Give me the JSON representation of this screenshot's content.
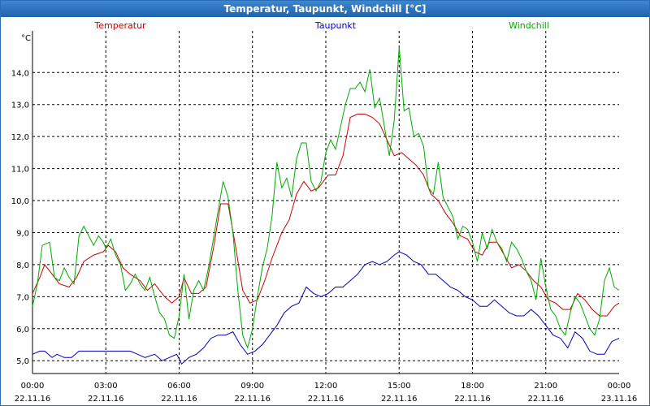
{
  "window": {
    "title": "Temperatur, Taupunkt, Windchill [°C]"
  },
  "chart_data": {
    "type": "line",
    "title": "Temperatur, Taupunkt, Windchill [°C]",
    "ylabel": "°C",
    "ylim": [
      4.6,
      15.3
    ],
    "xlim": [
      0,
      24
    ],
    "grid": true,
    "legend": "top",
    "y_ticks": [
      "5,0",
      "6,0",
      "7,0",
      "8,0",
      "9,0",
      "10,0",
      "11,0",
      "12,0",
      "13,0",
      "14,0"
    ],
    "y_tick_values": [
      5,
      6,
      7,
      8,
      9,
      10,
      11,
      12,
      13,
      14
    ],
    "x_ticks": [
      {
        "hour": 0,
        "time": "00:00",
        "date": "22.11.16"
      },
      {
        "hour": 3,
        "time": "03:00",
        "date": "22.11.16"
      },
      {
        "hour": 6,
        "time": "06:00",
        "date": "22.11.16"
      },
      {
        "hour": 9,
        "time": "09:00",
        "date": "22.11.16"
      },
      {
        "hour": 12,
        "time": "12:00",
        "date": "22.11.16"
      },
      {
        "hour": 15,
        "time": "15:00",
        "date": "22.11.16"
      },
      {
        "hour": 18,
        "time": "18:00",
        "date": "22.11.16"
      },
      {
        "hour": 21,
        "time": "21:00",
        "date": "22.11.16"
      },
      {
        "hour": 24,
        "time": "00:00",
        "date": "23.11.16"
      }
    ],
    "series": [
      {
        "name": "Temperatur",
        "color": "#cc0000",
        "points": [
          [
            0,
            7.1
          ],
          [
            0.3,
            7.6
          ],
          [
            0.5,
            8.0
          ],
          [
            0.8,
            7.7
          ],
          [
            1.1,
            7.4
          ],
          [
            1.5,
            7.3
          ],
          [
            1.8,
            7.6
          ],
          [
            2.1,
            8.1
          ],
          [
            2.5,
            8.3
          ],
          [
            2.9,
            8.4
          ],
          [
            3.1,
            8.6
          ],
          [
            3.4,
            8.4
          ],
          [
            3.7,
            7.9
          ],
          [
            4.0,
            7.7
          ],
          [
            4.4,
            7.5
          ],
          [
            4.7,
            7.2
          ],
          [
            5.0,
            7.4
          ],
          [
            5.4,
            7.0
          ],
          [
            5.7,
            6.8
          ],
          [
            6.0,
            7.0
          ],
          [
            6.2,
            7.6
          ],
          [
            6.5,
            7.1
          ],
          [
            6.8,
            7.1
          ],
          [
            7.1,
            7.3
          ],
          [
            7.4,
            8.5
          ],
          [
            7.7,
            9.9
          ],
          [
            8.0,
            9.9
          ],
          [
            8.3,
            8.6
          ],
          [
            8.6,
            7.2
          ],
          [
            8.9,
            6.8
          ],
          [
            9.2,
            6.9
          ],
          [
            9.5,
            7.5
          ],
          [
            9.8,
            8.2
          ],
          [
            10.2,
            9.0
          ],
          [
            10.5,
            9.4
          ],
          [
            10.8,
            10.2
          ],
          [
            11.1,
            10.6
          ],
          [
            11.4,
            10.3
          ],
          [
            11.7,
            10.4
          ],
          [
            12.1,
            10.8
          ],
          [
            12.4,
            10.8
          ],
          [
            12.7,
            11.4
          ],
          [
            13.0,
            12.6
          ],
          [
            13.3,
            12.7
          ],
          [
            13.6,
            12.7
          ],
          [
            13.9,
            12.6
          ],
          [
            14.2,
            12.4
          ],
          [
            14.5,
            11.9
          ],
          [
            14.8,
            11.4
          ],
          [
            15.1,
            11.5
          ],
          [
            15.4,
            11.3
          ],
          [
            15.7,
            11.1
          ],
          [
            16.0,
            10.8
          ],
          [
            16.3,
            10.2
          ],
          [
            16.6,
            10.0
          ],
          [
            16.9,
            9.6
          ],
          [
            17.2,
            9.3
          ],
          [
            17.5,
            8.9
          ],
          [
            17.8,
            8.8
          ],
          [
            18.1,
            8.4
          ],
          [
            18.4,
            8.3
          ],
          [
            18.7,
            8.7
          ],
          [
            19.0,
            8.7
          ],
          [
            19.3,
            8.3
          ],
          [
            19.6,
            7.9
          ],
          [
            19.9,
            8.0
          ],
          [
            20.2,
            7.8
          ],
          [
            20.5,
            7.5
          ],
          [
            20.8,
            7.3
          ],
          [
            21.1,
            6.9
          ],
          [
            21.4,
            6.8
          ],
          [
            21.7,
            6.6
          ],
          [
            22.0,
            6.6
          ],
          [
            22.3,
            7.1
          ],
          [
            22.6,
            6.9
          ],
          [
            22.9,
            6.6
          ],
          [
            23.2,
            6.4
          ],
          [
            23.5,
            6.4
          ],
          [
            23.8,
            6.7
          ],
          [
            24.0,
            6.8
          ]
        ]
      },
      {
        "name": "Taupunkt",
        "color": "#0000bb",
        "points": [
          [
            0,
            5.2
          ],
          [
            0.3,
            5.3
          ],
          [
            0.5,
            5.3
          ],
          [
            0.8,
            5.1
          ],
          [
            1.0,
            5.2
          ],
          [
            1.3,
            5.1
          ],
          [
            1.6,
            5.1
          ],
          [
            1.9,
            5.3
          ],
          [
            2.2,
            5.3
          ],
          [
            2.6,
            5.3
          ],
          [
            3.0,
            5.3
          ],
          [
            3.4,
            5.3
          ],
          [
            3.7,
            5.3
          ],
          [
            4.0,
            5.3
          ],
          [
            4.3,
            5.2
          ],
          [
            4.6,
            5.1
          ],
          [
            5.0,
            5.2
          ],
          [
            5.3,
            5.0
          ],
          [
            5.6,
            5.1
          ],
          [
            5.9,
            5.2
          ],
          [
            6.1,
            4.9
          ],
          [
            6.4,
            5.1
          ],
          [
            6.7,
            5.2
          ],
          [
            7.0,
            5.4
          ],
          [
            7.3,
            5.7
          ],
          [
            7.6,
            5.8
          ],
          [
            7.9,
            5.8
          ],
          [
            8.2,
            5.9
          ],
          [
            8.5,
            5.5
          ],
          [
            8.8,
            5.2
          ],
          [
            9.1,
            5.3
          ],
          [
            9.4,
            5.5
          ],
          [
            9.7,
            5.8
          ],
          [
            10.0,
            6.1
          ],
          [
            10.3,
            6.5
          ],
          [
            10.6,
            6.7
          ],
          [
            10.9,
            6.8
          ],
          [
            11.2,
            7.3
          ],
          [
            11.5,
            7.1
          ],
          [
            11.8,
            7.0
          ],
          [
            12.1,
            7.1
          ],
          [
            12.4,
            7.3
          ],
          [
            12.7,
            7.3
          ],
          [
            13.0,
            7.5
          ],
          [
            13.3,
            7.7
          ],
          [
            13.6,
            8.0
          ],
          [
            13.9,
            8.1
          ],
          [
            14.2,
            8.0
          ],
          [
            14.5,
            8.1
          ],
          [
            14.8,
            8.3
          ],
          [
            15.0,
            8.4
          ],
          [
            15.3,
            8.3
          ],
          [
            15.6,
            8.1
          ],
          [
            15.9,
            8.0
          ],
          [
            16.2,
            7.7
          ],
          [
            16.5,
            7.7
          ],
          [
            16.8,
            7.5
          ],
          [
            17.1,
            7.3
          ],
          [
            17.4,
            7.2
          ],
          [
            17.7,
            7.0
          ],
          [
            18.0,
            6.9
          ],
          [
            18.3,
            6.7
          ],
          [
            18.6,
            6.7
          ],
          [
            18.9,
            6.9
          ],
          [
            19.2,
            6.7
          ],
          [
            19.5,
            6.5
          ],
          [
            19.8,
            6.4
          ],
          [
            20.1,
            6.4
          ],
          [
            20.4,
            6.6
          ],
          [
            20.7,
            6.4
          ],
          [
            21.0,
            6.1
          ],
          [
            21.3,
            5.8
          ],
          [
            21.6,
            5.7
          ],
          [
            21.9,
            5.4
          ],
          [
            22.2,
            5.9
          ],
          [
            22.5,
            5.7
          ],
          [
            22.8,
            5.3
          ],
          [
            23.1,
            5.2
          ],
          [
            23.4,
            5.2
          ],
          [
            23.7,
            5.6
          ],
          [
            24.0,
            5.7
          ]
        ]
      },
      {
        "name": "Windchill",
        "color": "#00aa00",
        "points": [
          [
            0,
            6.7
          ],
          [
            0.2,
            7.4
          ],
          [
            0.4,
            8.6
          ],
          [
            0.7,
            8.7
          ],
          [
            0.9,
            7.6
          ],
          [
            1.1,
            7.5
          ],
          [
            1.3,
            7.9
          ],
          [
            1.5,
            7.6
          ],
          [
            1.7,
            7.4
          ],
          [
            1.9,
            8.9
          ],
          [
            2.1,
            9.2
          ],
          [
            2.3,
            8.9
          ],
          [
            2.5,
            8.6
          ],
          [
            2.7,
            8.9
          ],
          [
            2.9,
            8.7
          ],
          [
            3.0,
            8.5
          ],
          [
            3.2,
            8.8
          ],
          [
            3.4,
            8.3
          ],
          [
            3.6,
            8.0
          ],
          [
            3.8,
            7.2
          ],
          [
            4.0,
            7.4
          ],
          [
            4.2,
            7.7
          ],
          [
            4.4,
            7.4
          ],
          [
            4.6,
            7.2
          ],
          [
            4.8,
            7.6
          ],
          [
            5.0,
            7.0
          ],
          [
            5.2,
            6.5
          ],
          [
            5.4,
            6.3
          ],
          [
            5.6,
            5.8
          ],
          [
            5.8,
            5.7
          ],
          [
            6.0,
            6.4
          ],
          [
            6.2,
            7.7
          ],
          [
            6.4,
            6.3
          ],
          [
            6.6,
            7.2
          ],
          [
            6.8,
            7.5
          ],
          [
            7.0,
            7.2
          ],
          [
            7.2,
            7.9
          ],
          [
            7.4,
            8.8
          ],
          [
            7.6,
            9.7
          ],
          [
            7.8,
            10.6
          ],
          [
            8.0,
            10.1
          ],
          [
            8.2,
            9.0
          ],
          [
            8.4,
            7.2
          ],
          [
            8.6,
            5.8
          ],
          [
            8.8,
            5.4
          ],
          [
            9.0,
            6.0
          ],
          [
            9.2,
            7.0
          ],
          [
            9.4,
            7.9
          ],
          [
            9.6,
            8.5
          ],
          [
            9.8,
            9.5
          ],
          [
            10.0,
            11.2
          ],
          [
            10.2,
            10.4
          ],
          [
            10.4,
            10.7
          ],
          [
            10.6,
            10.1
          ],
          [
            10.8,
            11.3
          ],
          [
            11.0,
            11.8
          ],
          [
            11.2,
            11.8
          ],
          [
            11.4,
            10.6
          ],
          [
            11.6,
            10.3
          ],
          [
            11.8,
            10.6
          ],
          [
            12.0,
            11.5
          ],
          [
            12.2,
            11.9
          ],
          [
            12.4,
            11.6
          ],
          [
            12.6,
            12.3
          ],
          [
            12.8,
            13.0
          ],
          [
            13.0,
            13.5
          ],
          [
            13.2,
            13.5
          ],
          [
            13.4,
            13.7
          ],
          [
            13.6,
            13.4
          ],
          [
            13.8,
            14.1
          ],
          [
            14.0,
            12.9
          ],
          [
            14.2,
            13.2
          ],
          [
            14.4,
            12.3
          ],
          [
            14.6,
            11.4
          ],
          [
            14.8,
            12.5
          ],
          [
            15.0,
            14.8
          ],
          [
            15.2,
            12.8
          ],
          [
            15.4,
            12.9
          ],
          [
            15.6,
            12.0
          ],
          [
            15.8,
            12.1
          ],
          [
            16.0,
            11.7
          ],
          [
            16.2,
            10.4
          ],
          [
            16.4,
            10.2
          ],
          [
            16.6,
            11.2
          ],
          [
            16.8,
            10.1
          ],
          [
            17.0,
            9.8
          ],
          [
            17.2,
            9.5
          ],
          [
            17.4,
            8.8
          ],
          [
            17.6,
            9.2
          ],
          [
            17.8,
            9.1
          ],
          [
            18.0,
            8.7
          ],
          [
            18.2,
            8.1
          ],
          [
            18.4,
            9.0
          ],
          [
            18.6,
            8.5
          ],
          [
            18.8,
            9.1
          ],
          [
            19.0,
            8.7
          ],
          [
            19.2,
            8.5
          ],
          [
            19.4,
            8.1
          ],
          [
            19.6,
            8.7
          ],
          [
            19.8,
            8.5
          ],
          [
            20.0,
            8.2
          ],
          [
            20.2,
            7.8
          ],
          [
            20.4,
            7.5
          ],
          [
            20.6,
            6.9
          ],
          [
            20.8,
            8.2
          ],
          [
            21.0,
            7.3
          ],
          [
            21.2,
            6.6
          ],
          [
            21.4,
            6.4
          ],
          [
            21.6,
            6.0
          ],
          [
            21.8,
            5.8
          ],
          [
            22.0,
            6.5
          ],
          [
            22.2,
            7.0
          ],
          [
            22.4,
            6.8
          ],
          [
            22.6,
            6.4
          ],
          [
            22.8,
            6.0
          ],
          [
            23.0,
            5.8
          ],
          [
            23.2,
            6.3
          ],
          [
            23.4,
            7.5
          ],
          [
            23.6,
            7.9
          ],
          [
            23.8,
            7.3
          ],
          [
            24.0,
            7.2
          ]
        ]
      }
    ]
  }
}
